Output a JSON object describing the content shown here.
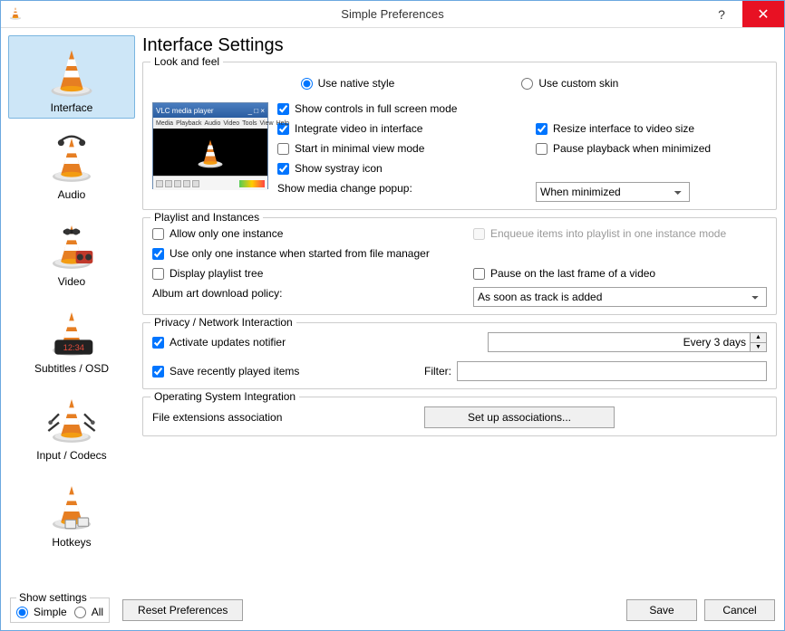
{
  "window": {
    "title": "Simple Preferences"
  },
  "sidebar": {
    "items": [
      {
        "label": "Interface"
      },
      {
        "label": "Audio"
      },
      {
        "label": "Video"
      },
      {
        "label": "Subtitles / OSD"
      },
      {
        "label": "Input / Codecs"
      },
      {
        "label": "Hotkeys"
      }
    ]
  },
  "page_title": "Interface Settings",
  "look": {
    "legend": "Look and feel",
    "native": "Use native style",
    "custom": "Use custom skin",
    "show_controls": "Show controls in full screen mode",
    "integrate_video": "Integrate video in interface",
    "resize_interface": "Resize interface to video size",
    "start_minimal": "Start in minimal view mode",
    "pause_minimized_playback": "Pause playback when minimized",
    "show_systray": "Show systray icon",
    "media_change_label": "Show media change popup:",
    "media_change_value": "When minimized",
    "preview_title": "VLC media player",
    "preview_menu": [
      "Media",
      "Playback",
      "Audio",
      "Video",
      "Tools",
      "View",
      "Help"
    ]
  },
  "playlist": {
    "legend": "Playlist and Instances",
    "allow_one": "Allow only one instance",
    "enqueue": "Enqueue items into playlist in one instance mode",
    "use_one_fm": "Use only one instance when started from file manager",
    "display_tree": "Display playlist tree",
    "pause_last_frame": "Pause on the last frame of a video",
    "album_art_label": "Album art download policy:",
    "album_art_value": "As soon as track is added"
  },
  "privacy": {
    "legend": "Privacy / Network Interaction",
    "activate_updates": "Activate updates notifier",
    "updates_value": "Every 3 days",
    "save_recent": "Save recently played items",
    "filter_label": "Filter:",
    "filter_value": ""
  },
  "os": {
    "legend": "Operating System Integration",
    "file_assoc_label": "File extensions association",
    "setup_btn": "Set up associations..."
  },
  "footer": {
    "show_settings": "Show settings",
    "simple": "Simple",
    "all": "All",
    "reset": "Reset Preferences",
    "save": "Save",
    "cancel": "Cancel"
  }
}
